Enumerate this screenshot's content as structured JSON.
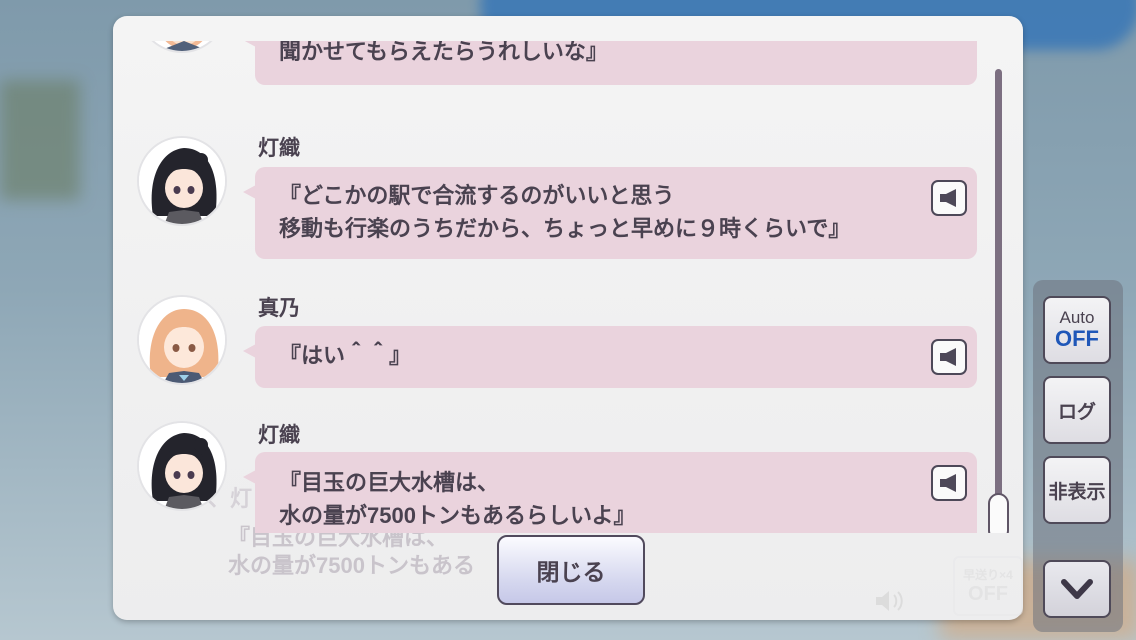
{
  "log": {
    "entries": [
      {
        "speaker": "",
        "character": "mano",
        "text": "聞かせてもらえたらうれしいな』",
        "has_voice": false
      },
      {
        "speaker": "灯織",
        "character": "hiori",
        "text": "『どこかの駅で合流するのがいいと思う\n移動も行楽のうちだから、ちょっと早めに９時くらいで』",
        "has_voice": true
      },
      {
        "speaker": "真乃",
        "character": "mano",
        "text": "『はい＾＾』",
        "has_voice": true
      },
      {
        "speaker": "灯織",
        "character": "hiori",
        "text": "『目玉の巨大水槽は、\n水の量が7500トンもあるらしいよ』",
        "has_voice": true
      }
    ],
    "close_label": "閉じる"
  },
  "background_dialog": {
    "text": "『目玉の巨大水槽は、\n水の量が7500トンもある"
  },
  "side_panel": {
    "auto_label": "Auto",
    "auto_state": "OFF",
    "log_label": "ログ",
    "hide_label": "非表示"
  },
  "colors": {
    "bubble": "#ead3dd",
    "text": "#4a4250",
    "auto_off": "#1f57b8"
  }
}
